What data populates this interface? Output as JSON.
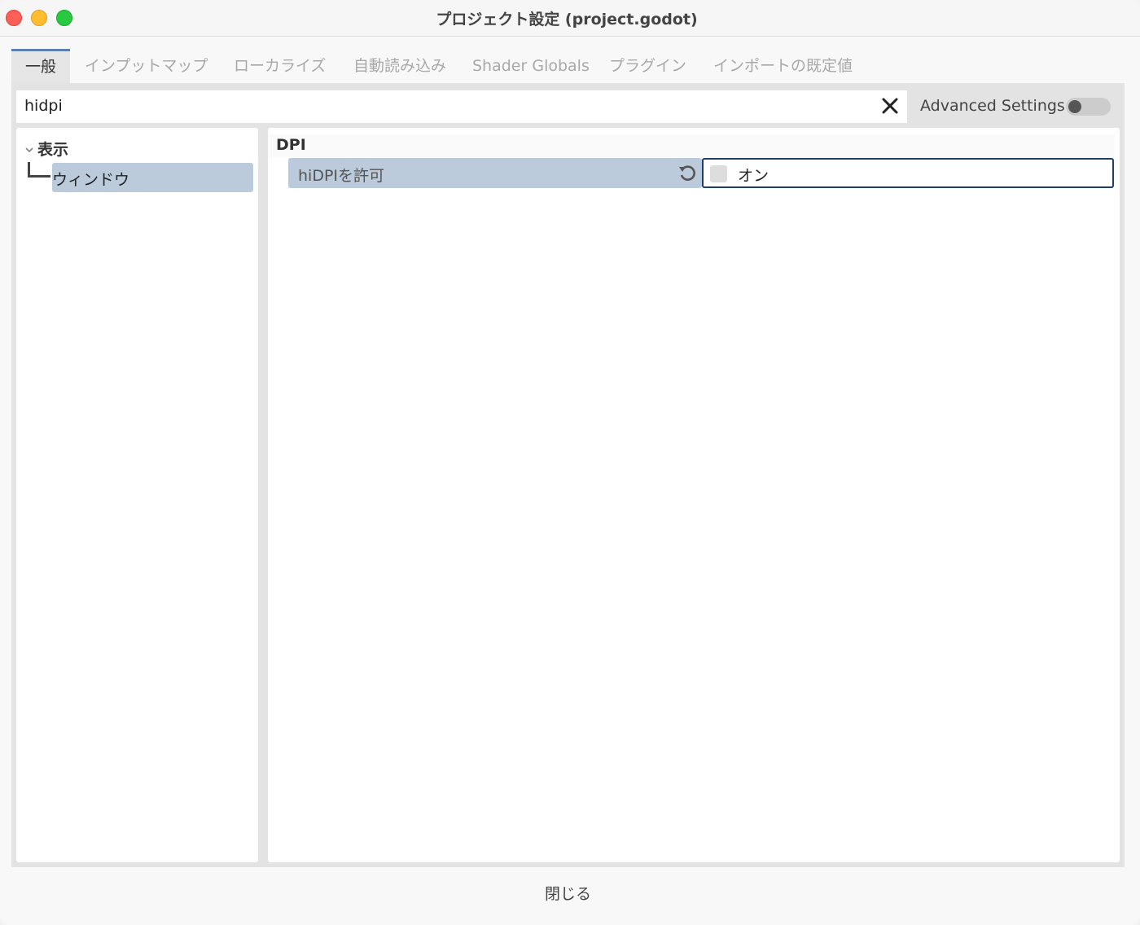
{
  "window": {
    "title": "プロジェクト設定 (project.godot)"
  },
  "tabs": [
    {
      "label": "一般",
      "active": true
    },
    {
      "label": "インプットマップ",
      "active": false
    },
    {
      "label": "ローカライズ",
      "active": false
    },
    {
      "label": "自動読み込み",
      "active": false
    },
    {
      "label": "Shader Globals",
      "active": false
    },
    {
      "label": "プラグイン",
      "active": false
    },
    {
      "label": "インポートの既定値",
      "active": false
    }
  ],
  "search": {
    "value": "hidpi",
    "clear_icon": "close-icon"
  },
  "advanced_settings": {
    "label": "Advanced Settings",
    "enabled": false
  },
  "tree": {
    "root": {
      "label": "表示",
      "expanded": true
    },
    "items": [
      {
        "label": "ウィンドウ",
        "selected": true
      }
    ]
  },
  "inspector": {
    "section": "DPI",
    "properties": [
      {
        "label": "hiDPIを許可",
        "value_label": "オン",
        "checked": false,
        "revert_icon": "revert-icon"
      }
    ]
  },
  "footer": {
    "close_label": "閉じる"
  },
  "colors": {
    "accent": "#5a7fb0",
    "selection": "#bbcbdb",
    "focus_border": "#1c3f6e"
  }
}
